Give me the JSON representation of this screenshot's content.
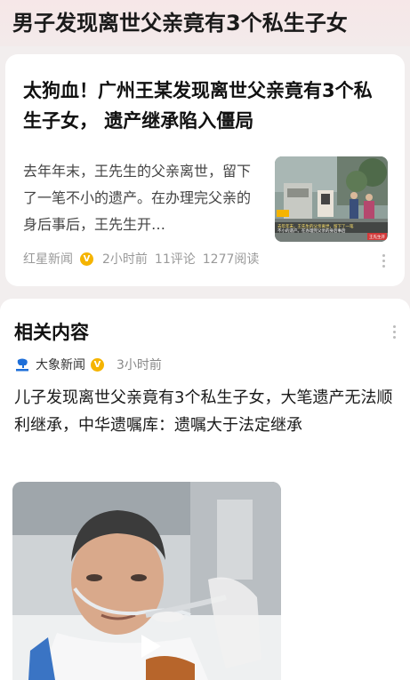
{
  "top": {
    "title": "男子发现离世父亲竟有3个私生子女"
  },
  "article": {
    "title": "太狗血！广州王某发现离世父亲竟有3个私生子女， 遗产继承陷入僵局",
    "summary": "去年年末，王先生的父亲离世，留下了一笔不小的遗产。在办理完父亲的身后事后，王先生开…",
    "thumbnail_caption_1": "去年年末，王先生的父亲离世，留下了一笔",
    "thumbnail_caption_2": "不小的遗产。在办理完父亲的身后事后",
    "thumbnail_name_tag": "王先生开",
    "source": "红星新闻",
    "verified_badge": "V",
    "time": "2小时前",
    "comments": "11评论",
    "reads": "1277阅读"
  },
  "related": {
    "heading": "相关内容",
    "source": "大象新闻",
    "verified_badge": "V",
    "time": "3小时前",
    "title": "儿子发现离世父亲竟有3个私生子女，大笔遗产无法顺利继承，中华遗嘱库：遗嘱大于法定继承"
  },
  "icons": {
    "more": "more-dots-icon",
    "play": "play-icon",
    "verified": "verified-v-icon",
    "source_logo": "daxiang-logo-icon"
  },
  "colors": {
    "background": "#f2eeee",
    "badge": "#f5b400",
    "meta": "#999999"
  }
}
